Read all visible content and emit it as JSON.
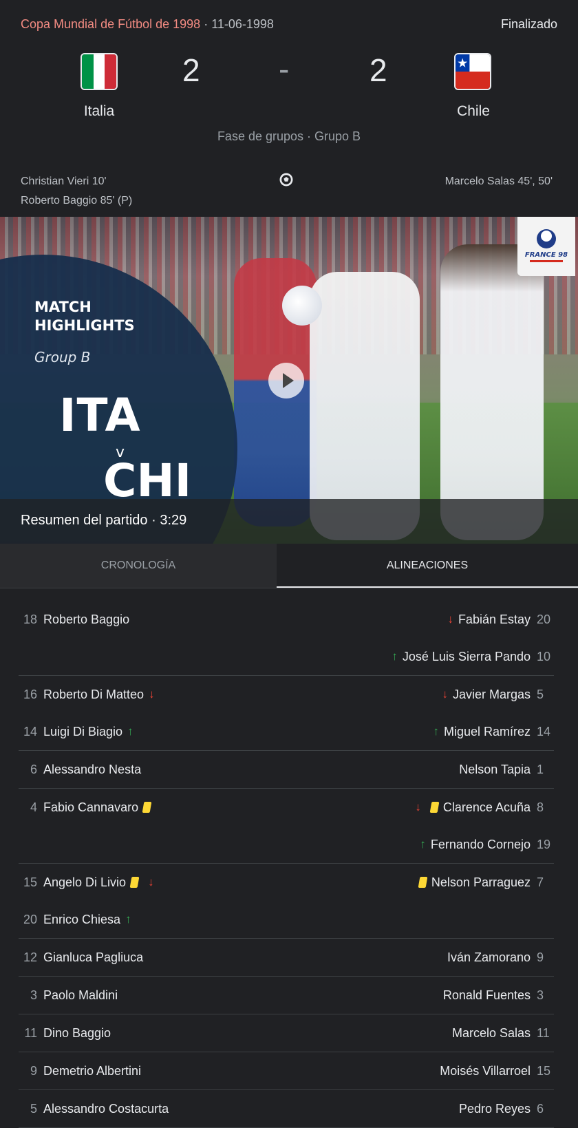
{
  "header": {
    "competition": "Copa Mundial de Fútbol de 1998",
    "date": "· 11-06-1998",
    "status": "Finalizado",
    "home": {
      "name": "Italia",
      "score": "2",
      "flag_colors": [
        "#009246",
        "#ffffff",
        "#ce2b37"
      ]
    },
    "separator": "-",
    "away": {
      "name": "Chile",
      "score": "2",
      "flag_colors": [
        "#0039a6",
        "#ffffff",
        "#d52b1e"
      ]
    },
    "stage": "Fase de grupos · Grupo B",
    "home_scorers": [
      "Christian Vieri 10'",
      "Roberto Baggio 85' (P)"
    ],
    "away_scorers": [
      "Marcelo Salas 45', 50'"
    ],
    "goal_icon": "soccer-ball-icon"
  },
  "video": {
    "title_line1": "MATCH",
    "title_line2": "HIGHLIGHTS",
    "group": "Group B",
    "team1": "ITA",
    "vs": "v",
    "team2": "CHI",
    "logo_text": "FRANCE 98",
    "caption": "Resumen del partido · 3:29"
  },
  "tabs": [
    {
      "label": "CRONOLOGÍA",
      "selected": false
    },
    {
      "label": "ALINEACIONES",
      "selected": true
    }
  ],
  "lineups": [
    {
      "rows": [
        {
          "home": {
            "num": "18",
            "name": "Roberto Baggio",
            "icons": []
          },
          "away": {
            "num": "20",
            "name": "Fabián Estay",
            "icons": [
              "down"
            ]
          }
        },
        {
          "home": null,
          "away": {
            "num": "10",
            "name": "José Luis Sierra Pando",
            "icons": [
              "up"
            ]
          }
        }
      ]
    },
    {
      "rows": [
        {
          "home": {
            "num": "16",
            "name": "Roberto Di Matteo",
            "icons": [
              "down"
            ]
          },
          "away": {
            "num": "5",
            "name": "Javier Margas",
            "icons": [
              "down"
            ]
          }
        },
        {
          "home": {
            "num": "14",
            "name": "Luigi Di Biagio",
            "icons": [
              "up"
            ]
          },
          "away": {
            "num": "14",
            "name": "Miguel Ramírez",
            "icons": [
              "up"
            ]
          }
        }
      ]
    },
    {
      "rows": [
        {
          "home": {
            "num": "6",
            "name": "Alessandro Nesta",
            "icons": []
          },
          "away": {
            "num": "1",
            "name": "Nelson Tapia",
            "icons": []
          }
        }
      ]
    },
    {
      "rows": [
        {
          "home": {
            "num": "4",
            "name": "Fabio Cannavaro",
            "icons": [
              "card"
            ]
          },
          "away": {
            "num": "8",
            "name": "Clarence Acuña",
            "icons": [
              "down",
              "card"
            ]
          }
        },
        {
          "home": null,
          "away": {
            "num": "19",
            "name": "Fernando Cornejo",
            "icons": [
              "up"
            ]
          }
        }
      ]
    },
    {
      "rows": [
        {
          "home": {
            "num": "15",
            "name": "Angelo Di Livio",
            "icons": [
              "card",
              "down"
            ]
          },
          "away": {
            "num": "7",
            "name": "Nelson Parraguez",
            "icons": [
              "card"
            ]
          }
        },
        {
          "home": {
            "num": "20",
            "name": "Enrico Chiesa",
            "icons": [
              "up"
            ]
          },
          "away": null
        }
      ]
    },
    {
      "rows": [
        {
          "home": {
            "num": "12",
            "name": "Gianluca Pagliuca",
            "icons": []
          },
          "away": {
            "num": "9",
            "name": "Iván Zamorano",
            "icons": []
          }
        }
      ]
    },
    {
      "rows": [
        {
          "home": {
            "num": "3",
            "name": "Paolo Maldini",
            "icons": []
          },
          "away": {
            "num": "3",
            "name": "Ronald Fuentes",
            "icons": []
          }
        }
      ]
    },
    {
      "rows": [
        {
          "home": {
            "num": "11",
            "name": "Dino Baggio",
            "icons": []
          },
          "away": {
            "num": "11",
            "name": "Marcelo Salas",
            "icons": []
          }
        }
      ]
    },
    {
      "rows": [
        {
          "home": {
            "num": "9",
            "name": "Demetrio Albertini",
            "icons": []
          },
          "away": {
            "num": "15",
            "name": "Moisés Villarroel",
            "icons": []
          }
        }
      ]
    },
    {
      "rows": [
        {
          "home": {
            "num": "5",
            "name": "Alessandro Costacurta",
            "icons": []
          },
          "away": {
            "num": "6",
            "name": "Pedro Reyes",
            "icons": []
          }
        }
      ]
    }
  ]
}
